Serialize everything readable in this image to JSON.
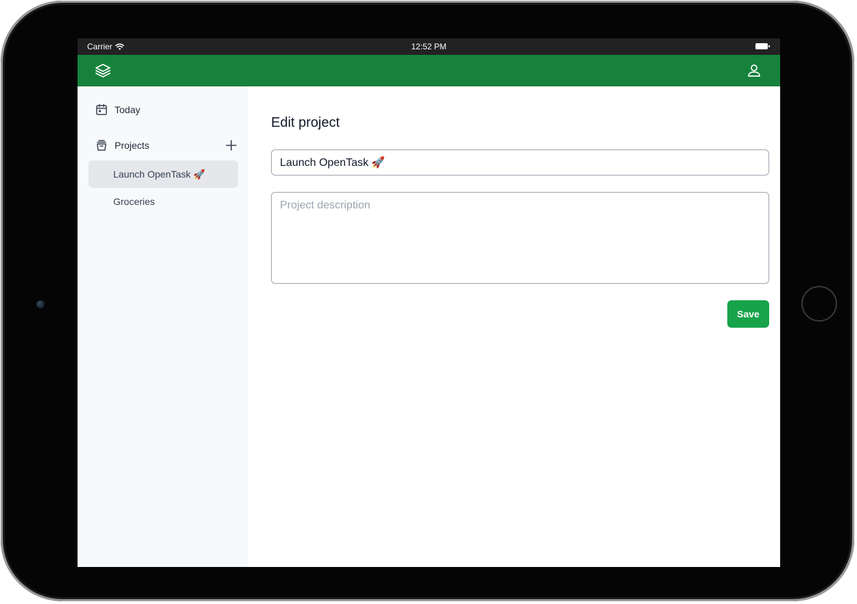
{
  "status_bar": {
    "carrier": "Carrier",
    "time": "12:52 PM"
  },
  "header": {
    "logo_icon": "layers-icon",
    "user_icon": "user-icon",
    "color": "#16823c"
  },
  "sidebar": {
    "today_label": "Today",
    "projects_label": "Projects",
    "projects": [
      {
        "label": "Launch OpenTask 🚀",
        "active": true
      },
      {
        "label": "Groceries",
        "active": false
      }
    ]
  },
  "main": {
    "title": "Edit project",
    "name_value": "Launch OpenTask 🚀",
    "description_value": "",
    "description_placeholder": "Project description",
    "save_label": "Save",
    "save_color": "#16a34a"
  }
}
